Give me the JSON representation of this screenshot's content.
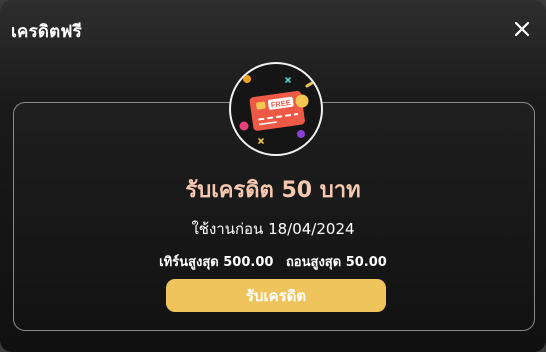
{
  "dialog": {
    "title": "เครดิตฟรี",
    "close_icon": "close-icon"
  },
  "reward": {
    "icon": "free-credit-card-icon",
    "card_text": "FREE",
    "heading": "รับเครดิต 50 บาท",
    "expiry": "ใช้งานก่อน 18/04/2024",
    "max_turnover": "เทิร์นสูงสุด 500.00",
    "max_withdraw": "ถอนสูงสุด 50.00",
    "claim_label": "รับเครดิต"
  },
  "colors": {
    "accent": "#f0c45c",
    "heading": "#f7c8b0",
    "card": "#ee5a45"
  }
}
